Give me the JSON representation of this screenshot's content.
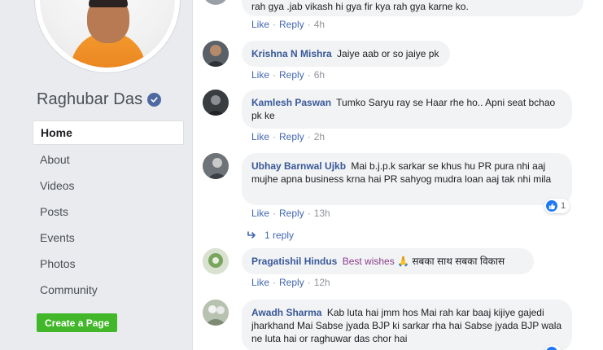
{
  "page": {
    "name": "Raghubar Das",
    "verified": true
  },
  "left_nav": {
    "items": [
      {
        "label": "Home",
        "active": true
      },
      {
        "label": "About",
        "active": false
      },
      {
        "label": "Videos",
        "active": false
      },
      {
        "label": "Posts",
        "active": false
      },
      {
        "label": "Events",
        "active": false
      },
      {
        "label": "Photos",
        "active": false
      },
      {
        "label": "Community",
        "active": false
      }
    ],
    "create_page_label": "Create a Page"
  },
  "actions": {
    "like": "Like",
    "reply": "Reply",
    "separator": "·"
  },
  "comments": [
    {
      "author": "",
      "text": "rah gya .jab vikash hi gya fir kya rah gya karne ko.",
      "time": "4h"
    },
    {
      "author": "Krishna N Mishra",
      "text": "Jaiye aab or so jaiye pk",
      "time": "6h"
    },
    {
      "author": "Kamlesh Paswan",
      "text": "Tumko Saryu ray se Haar rhe ho.. Apni seat bchao pk ke",
      "time": "2h"
    },
    {
      "author": "Ubhay Barnwal Ujkb",
      "text": "Mai b.j.p.k sarkar se khus hu PR pura nhi aaj mujhe apna business krna hai PR sahyog mudra loan aaj tak nhi mila",
      "time": "13h",
      "reactions": "1",
      "replies": "1 reply"
    },
    {
      "author": "Pragatishil Hindus",
      "tag": "Best wishes",
      "emoji": "🙏",
      "text": "सबका साथ सबका विकास",
      "time": "12h"
    },
    {
      "author": "Awadh Sharma",
      "text": "Kab luta hai jmm hos Mai rah kar baaj kijiye gajedi jharkhand Mai Sabse jyada BJP ki sarkar rha hai Sabse jyada BJP wala ne luta hai or raghuwar das chor hai",
      "time": ""
    }
  ],
  "colors": {
    "author_blue": "#385898",
    "link_blue": "#4267b2",
    "bubble_bg": "#f2f3f5",
    "page_bg": "#e9ebee",
    "create_green": "#42b72a",
    "like_blue": "#2078f4"
  }
}
